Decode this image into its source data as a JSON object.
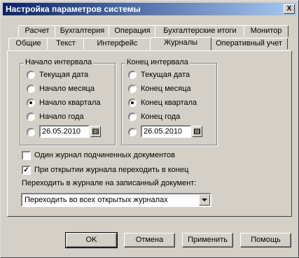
{
  "window": {
    "title": "Настройка параметров системы",
    "close": "X"
  },
  "tabs_row1": [
    "Расчет",
    "Бухгалтерия",
    "Операция",
    "Бухгалтерские итоги",
    "Монитор"
  ],
  "tabs_row2": [
    "Общие",
    "Текст",
    "Интерфейс",
    "Журналы",
    "Оперативный учет"
  ],
  "active_tab": "Журналы",
  "start_group": {
    "legend": "Начало интервала",
    "options": [
      "Текущая дата",
      "Начало месяца",
      "Начало квартала",
      "Начало года"
    ],
    "selected_index": 2,
    "date_value": "26.05.2010"
  },
  "end_group": {
    "legend": "Конец интервала",
    "options": [
      "Текущая дата",
      "Конец месяца",
      "Конец квартала",
      "Конец года"
    ],
    "selected_index": 2,
    "date_value": "26.05.2010"
  },
  "checkboxes": [
    {
      "label": "Один журнал подчиненных документов",
      "checked": false
    },
    {
      "label": "При открытии журнала переходить в конец",
      "checked": true
    }
  ],
  "goto_label": "Переходить в журнале на записанный документ:",
  "goto_select": "Переходить во всех открытых журналах",
  "buttons": {
    "ok": "OK",
    "cancel": "Отмена",
    "apply": "Применить",
    "help": "Помощь"
  }
}
